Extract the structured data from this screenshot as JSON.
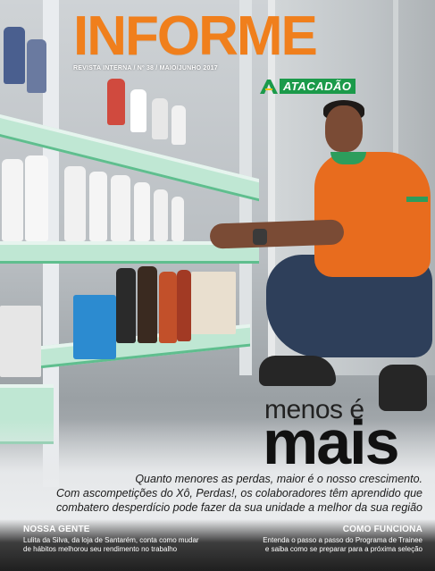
{
  "masthead": {
    "title": "INFORME",
    "issue_line": "REVISTA INTERNA / Nº 38 / MAIO/JUNHO 2017",
    "brand": "ATACADÃO"
  },
  "headline": {
    "line1": "menos é",
    "line2": "mais"
  },
  "deck": {
    "line1": "Quanto menores as perdas, maior é o nosso crescimento.",
    "line2": "Com ascompetições do Xô, Perdas!, os colaboradores têm aprendido que",
    "line3": "combatero desperdício pode fazer da sua unidade a melhor da sua região"
  },
  "sections": {
    "left": {
      "title": "NOSSA GENTE",
      "line1": "Lulita da Silva, da loja de Santarém, conta como mudar",
      "line2": "de hábitos melhorou seu rendimento no trabalho"
    },
    "right": {
      "title": "COMO FUNCIONA",
      "line1": "Entenda o passo a passo do Programa de Trainee",
      "line2": "e saiba como se preparar para a próxima seleção"
    }
  },
  "colors": {
    "masthead": "#f07f1c",
    "brand_green": "#1b9a4a",
    "shirt": "#e86c1e"
  }
}
